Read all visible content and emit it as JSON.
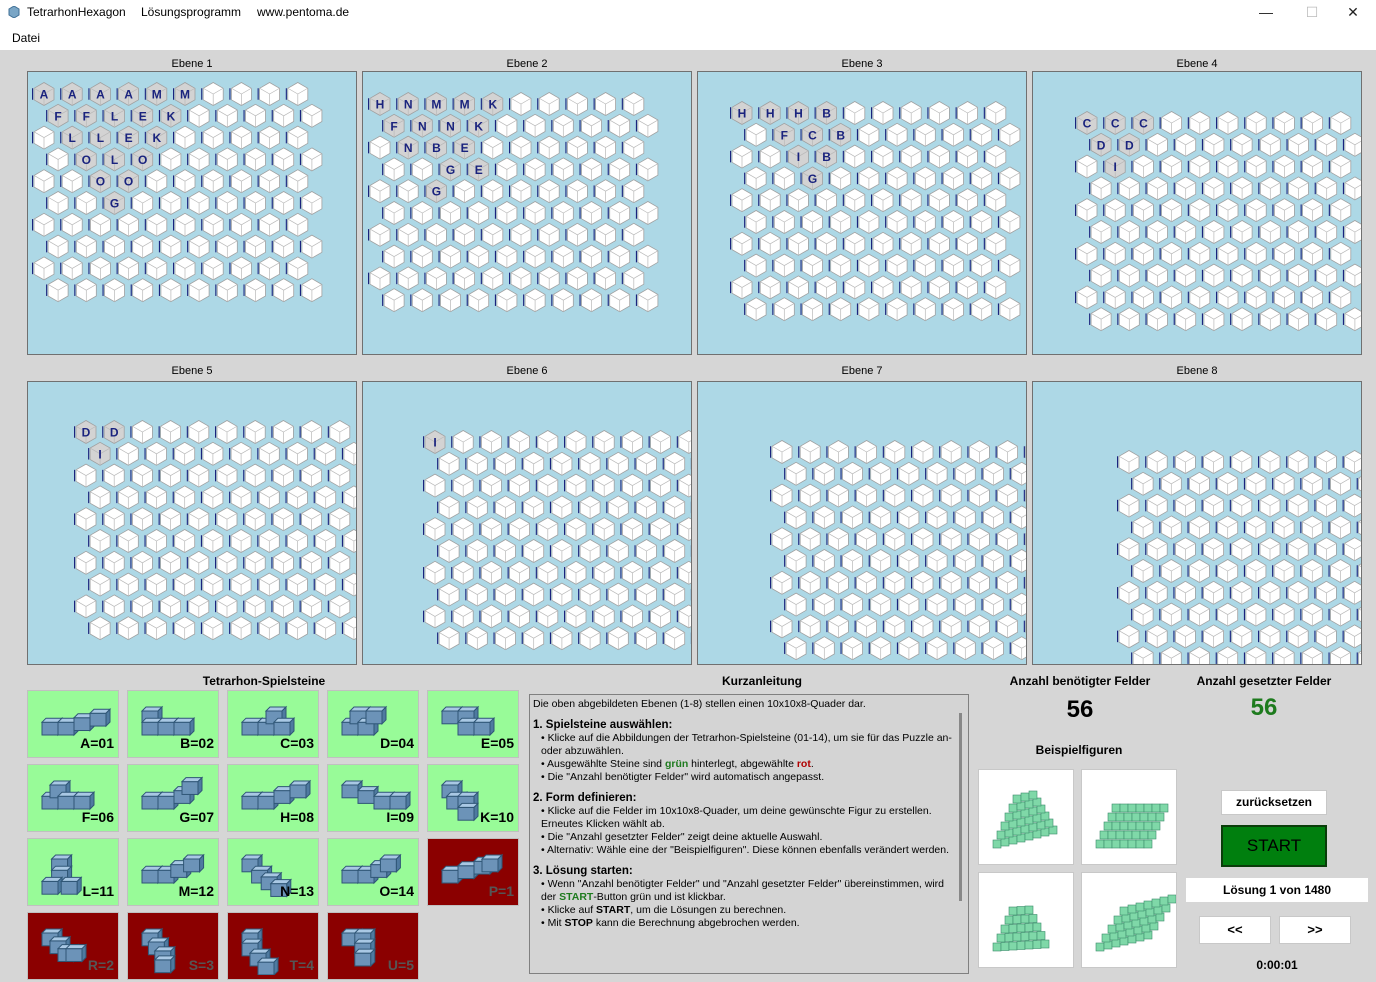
{
  "window": {
    "title": "TetrarhonHexagon",
    "subtitle": "Lösungsprogramm",
    "website": "www.pentoma.de",
    "minimize_glyph": "—",
    "maximize_glyph": "☐",
    "close_glyph": "✕"
  },
  "menu": {
    "file_label": "Datei"
  },
  "layers": [
    {
      "title": "Ebene 1",
      "labels": [
        [
          "A",
          "A",
          "A",
          "A",
          "M",
          "M",
          "",
          "",
          "",
          ""
        ],
        [
          "F",
          "F",
          "L",
          "E",
          "K",
          "",
          "",
          "",
          "",
          ""
        ],
        [
          "",
          "L",
          "L",
          "E",
          "K",
          "",
          "",
          "",
          "",
          ""
        ],
        [
          "",
          "O",
          "L",
          "O",
          "",
          "",
          "",
          "",
          "",
          ""
        ],
        [
          "",
          "",
          "O",
          "O",
          "",
          "",
          "",
          "",
          "",
          ""
        ],
        [
          "",
          "",
          "G",
          "",
          "",
          "",
          "",
          "",
          "",
          ""
        ],
        [
          "",
          "",
          "",
          "",
          "",
          "",
          "",
          "",
          "",
          ""
        ],
        [
          "",
          "",
          "",
          "",
          "",
          "",
          "",
          "",
          "",
          ""
        ],
        [
          "",
          "",
          "",
          "",
          "",
          "",
          "",
          "",
          "",
          ""
        ],
        [
          "",
          "",
          "",
          "",
          "",
          "",
          "",
          "",
          "",
          ""
        ]
      ]
    },
    {
      "title": "Ebene 2",
      "labels": [
        [
          "H",
          "N",
          "M",
          "M",
          "K",
          "",
          "",
          "",
          "",
          ""
        ],
        [
          "F",
          "N",
          "N",
          "K",
          "",
          "",
          "",
          "",
          "",
          ""
        ],
        [
          "",
          "N",
          "B",
          "E",
          "",
          "",
          "",
          "",
          "",
          ""
        ],
        [
          "",
          "",
          "G",
          "E",
          "",
          "",
          "",
          "",
          "",
          ""
        ],
        [
          "",
          "",
          "G",
          "",
          "",
          "",
          "",
          "",
          "",
          ""
        ],
        [
          "",
          "",
          "",
          "",
          "",
          "",
          "",
          "",
          "",
          ""
        ],
        [
          "",
          "",
          "",
          "",
          "",
          "",
          "",
          "",
          "",
          ""
        ],
        [
          "",
          "",
          "",
          "",
          "",
          "",
          "",
          "",
          "",
          ""
        ],
        [
          "",
          "",
          "",
          "",
          "",
          "",
          "",
          "",
          "",
          ""
        ],
        [
          "",
          "",
          "",
          "",
          "",
          "",
          "",
          "",
          "",
          ""
        ]
      ]
    },
    {
      "title": "Ebene 3",
      "labels": [
        [
          "H",
          "H",
          "H",
          "B",
          "",
          "",
          "",
          "",
          "",
          ""
        ],
        [
          "",
          "F",
          "C",
          "B",
          "",
          "",
          "",
          "",
          "",
          ""
        ],
        [
          "",
          "",
          "I",
          "B",
          "",
          "",
          "",
          "",
          "",
          ""
        ],
        [
          "",
          "",
          "G",
          "",
          "",
          "",
          "",
          "",
          "",
          ""
        ],
        [
          "",
          "",
          "",
          "",
          "",
          "",
          "",
          "",
          "",
          ""
        ],
        [
          "",
          "",
          "",
          "",
          "",
          "",
          "",
          "",
          "",
          ""
        ],
        [
          "",
          "",
          "",
          "",
          "",
          "",
          "",
          "",
          "",
          ""
        ],
        [
          "",
          "",
          "",
          "",
          "",
          "",
          "",
          "",
          "",
          ""
        ],
        [
          "",
          "",
          "",
          "",
          "",
          "",
          "",
          "",
          "",
          ""
        ],
        [
          "",
          "",
          "",
          "",
          "",
          "",
          "",
          "",
          "",
          ""
        ]
      ]
    },
    {
      "title": "Ebene 4",
      "labels": [
        [
          "C",
          "C",
          "C",
          "",
          "",
          "",
          "",
          "",
          "",
          ""
        ],
        [
          "D",
          "D",
          "",
          "",
          "",
          "",
          "",
          "",
          "",
          ""
        ],
        [
          "",
          "I",
          "",
          "",
          "",
          "",
          "",
          "",
          "",
          ""
        ],
        [
          "",
          "",
          "",
          "",
          "",
          "",
          "",
          "",
          "",
          ""
        ],
        [
          "",
          "",
          "",
          "",
          "",
          "",
          "",
          "",
          "",
          ""
        ],
        [
          "",
          "",
          "",
          "",
          "",
          "",
          "",
          "",
          "",
          ""
        ],
        [
          "",
          "",
          "",
          "",
          "",
          "",
          "",
          "",
          "",
          ""
        ],
        [
          "",
          "",
          "",
          "",
          "",
          "",
          "",
          "",
          "",
          ""
        ],
        [
          "",
          "",
          "",
          "",
          "",
          "",
          "",
          "",
          "",
          ""
        ],
        [
          "",
          "",
          "",
          "",
          "",
          "",
          "",
          "",
          "",
          ""
        ]
      ]
    },
    {
      "title": "Ebene 5",
      "labels": [
        [
          "D",
          "D",
          "",
          "",
          "",
          "",
          "",
          "",
          "",
          ""
        ],
        [
          "I",
          "",
          "",
          "",
          "",
          "",
          "",
          "",
          "",
          ""
        ],
        [
          "",
          "",
          "",
          "",
          "",
          "",
          "",
          "",
          "",
          ""
        ],
        [
          "",
          "",
          "",
          "",
          "",
          "",
          "",
          "",
          "",
          ""
        ],
        [
          "",
          "",
          "",
          "",
          "",
          "",
          "",
          "",
          "",
          ""
        ],
        [
          "",
          "",
          "",
          "",
          "",
          "",
          "",
          "",
          "",
          ""
        ],
        [
          "",
          "",
          "",
          "",
          "",
          "",
          "",
          "",
          "",
          ""
        ],
        [
          "",
          "",
          "",
          "",
          "",
          "",
          "",
          "",
          "",
          ""
        ],
        [
          "",
          "",
          "",
          "",
          "",
          "",
          "",
          "",
          "",
          ""
        ],
        [
          "",
          "",
          "",
          "",
          "",
          "",
          "",
          "",
          "",
          ""
        ]
      ]
    },
    {
      "title": "Ebene 6",
      "labels": [
        [
          "I",
          "",
          "",
          "",
          "",
          "",
          "",
          "",
          "",
          ""
        ],
        [
          "",
          "",
          "",
          "",
          "",
          "",
          "",
          "",
          "",
          ""
        ],
        [
          "",
          "",
          "",
          "",
          "",
          "",
          "",
          "",
          "",
          ""
        ],
        [
          "",
          "",
          "",
          "",
          "",
          "",
          "",
          "",
          "",
          ""
        ],
        [
          "",
          "",
          "",
          "",
          "",
          "",
          "",
          "",
          "",
          ""
        ],
        [
          "",
          "",
          "",
          "",
          "",
          "",
          "",
          "",
          "",
          ""
        ],
        [
          "",
          "",
          "",
          "",
          "",
          "",
          "",
          "",
          "",
          ""
        ],
        [
          "",
          "",
          "",
          "",
          "",
          "",
          "",
          "",
          "",
          ""
        ],
        [
          "",
          "",
          "",
          "",
          "",
          "",
          "",
          "",
          "",
          ""
        ],
        [
          "",
          "",
          "",
          "",
          "",
          "",
          "",
          "",
          "",
          ""
        ]
      ]
    },
    {
      "title": "Ebene 7",
      "labels": [
        [
          "",
          "",
          "",
          "",
          "",
          "",
          "",
          "",
          "",
          ""
        ],
        [
          "",
          "",
          "",
          "",
          "",
          "",
          "",
          "",
          "",
          ""
        ],
        [
          "",
          "",
          "",
          "",
          "",
          "",
          "",
          "",
          "",
          ""
        ],
        [
          "",
          "",
          "",
          "",
          "",
          "",
          "",
          "",
          "",
          ""
        ],
        [
          "",
          "",
          "",
          "",
          "",
          "",
          "",
          "",
          "",
          ""
        ],
        [
          "",
          "",
          "",
          "",
          "",
          "",
          "",
          "",
          "",
          ""
        ],
        [
          "",
          "",
          "",
          "",
          "",
          "",
          "",
          "",
          "",
          ""
        ],
        [
          "",
          "",
          "",
          "",
          "",
          "",
          "",
          "",
          "",
          ""
        ],
        [
          "",
          "",
          "",
          "",
          "",
          "",
          "",
          "",
          "",
          ""
        ],
        [
          "",
          "",
          "",
          "",
          "",
          "",
          "",
          "",
          "",
          ""
        ]
      ]
    },
    {
      "title": "Ebene 8",
      "labels": [
        [
          "",
          "",
          "",
          "",
          "",
          "",
          "",
          "",
          "",
          ""
        ],
        [
          "",
          "",
          "",
          "",
          "",
          "",
          "",
          "",
          "",
          ""
        ],
        [
          "",
          "",
          "",
          "",
          "",
          "",
          "",
          "",
          "",
          ""
        ],
        [
          "",
          "",
          "",
          "",
          "",
          "",
          "",
          "",
          "",
          ""
        ],
        [
          "",
          "",
          "",
          "",
          "",
          "",
          "",
          "",
          "",
          ""
        ],
        [
          "",
          "",
          "",
          "",
          "",
          "",
          "",
          "",
          "",
          ""
        ],
        [
          "",
          "",
          "",
          "",
          "",
          "",
          "",
          "",
          "",
          ""
        ],
        [
          "",
          "",
          "",
          "",
          "",
          "",
          "",
          "",
          "",
          ""
        ],
        [
          "",
          "",
          "",
          "",
          "",
          "",
          "",
          "",
          "",
          ""
        ],
        [
          "",
          "",
          "",
          "",
          "",
          "",
          "",
          "",
          "",
          ""
        ]
      ]
    }
  ],
  "pieces_title": "Tetrarhon-Spielsteine",
  "pieces": [
    {
      "label": "A=01",
      "selected": true,
      "shape": "a"
    },
    {
      "label": "B=02",
      "selected": true,
      "shape": "b"
    },
    {
      "label": "C=03",
      "selected": true,
      "shape": "c"
    },
    {
      "label": "D=04",
      "selected": true,
      "shape": "d"
    },
    {
      "label": "E=05",
      "selected": true,
      "shape": "e"
    },
    {
      "label": "F=06",
      "selected": true,
      "shape": "f"
    },
    {
      "label": "G=07",
      "selected": true,
      "shape": "g"
    },
    {
      "label": "H=08",
      "selected": true,
      "shape": "h"
    },
    {
      "label": "I=09",
      "selected": true,
      "shape": "i"
    },
    {
      "label": "K=10",
      "selected": true,
      "shape": "k"
    },
    {
      "label": "L=11",
      "selected": true,
      "shape": "l"
    },
    {
      "label": "M=12",
      "selected": true,
      "shape": "m"
    },
    {
      "label": "N=13",
      "selected": true,
      "shape": "n"
    },
    {
      "label": "O=14",
      "selected": true,
      "shape": "o"
    },
    {
      "label": "P=1",
      "selected": false,
      "shape": "p"
    },
    {
      "label": "R=2",
      "selected": false,
      "shape": "r"
    },
    {
      "label": "S=3",
      "selected": false,
      "shape": "s"
    },
    {
      "label": "T=4",
      "selected": false,
      "shape": "t"
    },
    {
      "label": "U=5",
      "selected": false,
      "shape": "u"
    }
  ],
  "instructions": {
    "title": "Kurzanleitung",
    "intro": "Die oben abgebildeten Ebenen (1-8) stellen einen 10x10x8-Quader dar.",
    "s1_head": "1. Spielsteine auswählen:",
    "s1_l1": "• Klicke auf die Abbildungen der Tetrarhon-Spielsteine (01-14), um sie für das Puzzle an- oder abzuwählen.",
    "s1_l2_pre": "• Ausgewählte Steine sind ",
    "s1_l2_green": "grün",
    "s1_l2_mid": " hinterlegt, abgewählte ",
    "s1_l2_red": "rot",
    "s1_l2_end": ".",
    "s1_l3": "• Die \"Anzahl benötigter Felder\" wird automatisch angepasst.",
    "s2_head": "2. Form definieren:",
    "s2_l1": "• Klicke auf die Felder im 10x10x8-Quader, um deine gewünschte Figur zu erstellen. Erneutes Klicken wählt ab.",
    "s2_l2": "• Die \"Anzahl gesetzter Felder\" zeigt deine aktuelle Auswahl.",
    "s2_l3": "• Alternativ: Wähle eine der \"Beispielfiguren\". Diese können ebenfalls verändert werden.",
    "s3_head": "3. Lösung starten:",
    "s3_l1_pre": "• Wenn \"Anzahl benötigter Felder\" und \"Anzahl gesetzter Felder\" übereinstimmen, wird der ",
    "s3_l1_start": "START",
    "s3_l1_end": "-Button grün und ist klickbar.",
    "s3_l2_pre": "• Klicke auf ",
    "s3_l2_start": "START",
    "s3_l2_end": ", um die Lösungen zu berechnen.",
    "s3_l3_pre": "• Mit ",
    "s3_l3_stop": "STOP",
    "s3_l3_end": " kann die Berechnung abgebrochen werden."
  },
  "counts": {
    "needed_label": "Anzahl benötigter Felder",
    "needed_value": "56",
    "set_label": "Anzahl gesetzter Felder",
    "set_value": "56",
    "set_color": "#1e7b1e"
  },
  "examples_title": "Beispielfiguren",
  "controls": {
    "reset_label": "zurücksetzen",
    "start_label": "START",
    "solution_text": "Lösung 1 von 1480",
    "prev_label": "<<",
    "next_label": ">>",
    "timer": "0:00:01"
  },
  "colors": {
    "layer_bg": "#add8e6",
    "selected_piece": "#98fb98",
    "unselected_piece": "#8b0000",
    "start_button": "#007f0e",
    "instruction_green": "#1e7b1e",
    "instruction_red": "#b00000",
    "cube_color": "#7fd8a8"
  }
}
